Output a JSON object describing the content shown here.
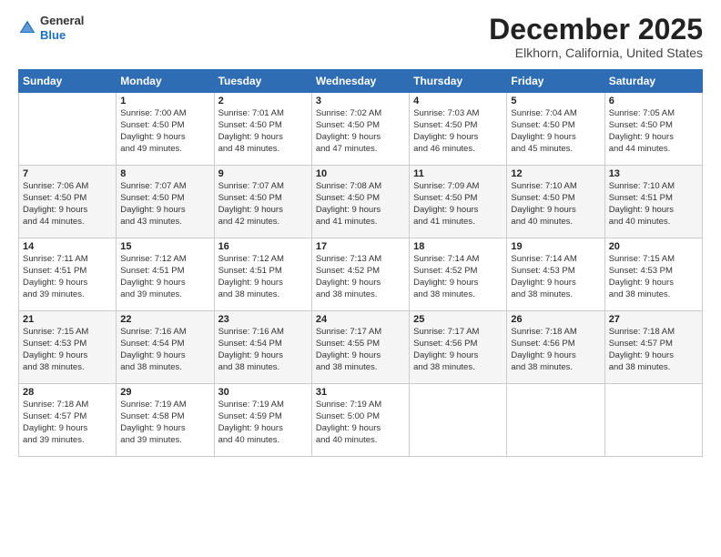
{
  "header": {
    "logo_general": "General",
    "logo_blue": "Blue",
    "month_title": "December 2025",
    "location": "Elkhorn, California, United States"
  },
  "days_of_week": [
    "Sunday",
    "Monday",
    "Tuesday",
    "Wednesday",
    "Thursday",
    "Friday",
    "Saturday"
  ],
  "weeks": [
    [
      {
        "day": "",
        "info": ""
      },
      {
        "day": "1",
        "info": "Sunrise: 7:00 AM\nSunset: 4:50 PM\nDaylight: 9 hours\nand 49 minutes."
      },
      {
        "day": "2",
        "info": "Sunrise: 7:01 AM\nSunset: 4:50 PM\nDaylight: 9 hours\nand 48 minutes."
      },
      {
        "day": "3",
        "info": "Sunrise: 7:02 AM\nSunset: 4:50 PM\nDaylight: 9 hours\nand 47 minutes."
      },
      {
        "day": "4",
        "info": "Sunrise: 7:03 AM\nSunset: 4:50 PM\nDaylight: 9 hours\nand 46 minutes."
      },
      {
        "day": "5",
        "info": "Sunrise: 7:04 AM\nSunset: 4:50 PM\nDaylight: 9 hours\nand 45 minutes."
      },
      {
        "day": "6",
        "info": "Sunrise: 7:05 AM\nSunset: 4:50 PM\nDaylight: 9 hours\nand 44 minutes."
      }
    ],
    [
      {
        "day": "7",
        "info": "Sunrise: 7:06 AM\nSunset: 4:50 PM\nDaylight: 9 hours\nand 44 minutes."
      },
      {
        "day": "8",
        "info": "Sunrise: 7:07 AM\nSunset: 4:50 PM\nDaylight: 9 hours\nand 43 minutes."
      },
      {
        "day": "9",
        "info": "Sunrise: 7:07 AM\nSunset: 4:50 PM\nDaylight: 9 hours\nand 42 minutes."
      },
      {
        "day": "10",
        "info": "Sunrise: 7:08 AM\nSunset: 4:50 PM\nDaylight: 9 hours\nand 41 minutes."
      },
      {
        "day": "11",
        "info": "Sunrise: 7:09 AM\nSunset: 4:50 PM\nDaylight: 9 hours\nand 41 minutes."
      },
      {
        "day": "12",
        "info": "Sunrise: 7:10 AM\nSunset: 4:50 PM\nDaylight: 9 hours\nand 40 minutes."
      },
      {
        "day": "13",
        "info": "Sunrise: 7:10 AM\nSunset: 4:51 PM\nDaylight: 9 hours\nand 40 minutes."
      }
    ],
    [
      {
        "day": "14",
        "info": "Sunrise: 7:11 AM\nSunset: 4:51 PM\nDaylight: 9 hours\nand 39 minutes."
      },
      {
        "day": "15",
        "info": "Sunrise: 7:12 AM\nSunset: 4:51 PM\nDaylight: 9 hours\nand 39 minutes."
      },
      {
        "day": "16",
        "info": "Sunrise: 7:12 AM\nSunset: 4:51 PM\nDaylight: 9 hours\nand 38 minutes."
      },
      {
        "day": "17",
        "info": "Sunrise: 7:13 AM\nSunset: 4:52 PM\nDaylight: 9 hours\nand 38 minutes."
      },
      {
        "day": "18",
        "info": "Sunrise: 7:14 AM\nSunset: 4:52 PM\nDaylight: 9 hours\nand 38 minutes."
      },
      {
        "day": "19",
        "info": "Sunrise: 7:14 AM\nSunset: 4:53 PM\nDaylight: 9 hours\nand 38 minutes."
      },
      {
        "day": "20",
        "info": "Sunrise: 7:15 AM\nSunset: 4:53 PM\nDaylight: 9 hours\nand 38 minutes."
      }
    ],
    [
      {
        "day": "21",
        "info": "Sunrise: 7:15 AM\nSunset: 4:53 PM\nDaylight: 9 hours\nand 38 minutes."
      },
      {
        "day": "22",
        "info": "Sunrise: 7:16 AM\nSunset: 4:54 PM\nDaylight: 9 hours\nand 38 minutes."
      },
      {
        "day": "23",
        "info": "Sunrise: 7:16 AM\nSunset: 4:54 PM\nDaylight: 9 hours\nand 38 minutes."
      },
      {
        "day": "24",
        "info": "Sunrise: 7:17 AM\nSunset: 4:55 PM\nDaylight: 9 hours\nand 38 minutes."
      },
      {
        "day": "25",
        "info": "Sunrise: 7:17 AM\nSunset: 4:56 PM\nDaylight: 9 hours\nand 38 minutes."
      },
      {
        "day": "26",
        "info": "Sunrise: 7:18 AM\nSunset: 4:56 PM\nDaylight: 9 hours\nand 38 minutes."
      },
      {
        "day": "27",
        "info": "Sunrise: 7:18 AM\nSunset: 4:57 PM\nDaylight: 9 hours\nand 38 minutes."
      }
    ],
    [
      {
        "day": "28",
        "info": "Sunrise: 7:18 AM\nSunset: 4:57 PM\nDaylight: 9 hours\nand 39 minutes."
      },
      {
        "day": "29",
        "info": "Sunrise: 7:19 AM\nSunset: 4:58 PM\nDaylight: 9 hours\nand 39 minutes."
      },
      {
        "day": "30",
        "info": "Sunrise: 7:19 AM\nSunset: 4:59 PM\nDaylight: 9 hours\nand 40 minutes."
      },
      {
        "day": "31",
        "info": "Sunrise: 7:19 AM\nSunset: 5:00 PM\nDaylight: 9 hours\nand 40 minutes."
      },
      {
        "day": "",
        "info": ""
      },
      {
        "day": "",
        "info": ""
      },
      {
        "day": "",
        "info": ""
      }
    ]
  ]
}
